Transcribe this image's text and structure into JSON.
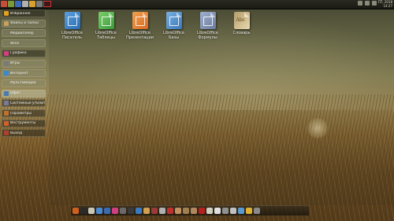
{
  "topbar": {
    "clock_line1": "ПТ, 2018",
    "clock_line2": "14:27",
    "icon_colors": [
      "#c84c3a",
      "#7a9a3a",
      "#3a6ab8",
      "#b0b0b0",
      "#d9a030",
      "#7a7a7a"
    ]
  },
  "menu": {
    "items": [
      {
        "label": "Избранное",
        "icon": "star-icon",
        "color": "#e0a020",
        "style": "dark"
      },
      {
        "label": "Файлы и папки",
        "icon": "folder-icon",
        "color": "#c8a060",
        "style": "normal"
      },
      {
        "label": "Медиаплеер",
        "icon": "",
        "color": "",
        "style": "normal"
      },
      {
        "label": "Wine",
        "icon": "",
        "color": "",
        "style": "normal"
      },
      {
        "label": "Графика",
        "icon": "graphics-icon",
        "color": "#d04080",
        "style": "dark"
      },
      {
        "label": "Игры",
        "icon": "game-icon",
        "color": "#7a7a7a",
        "style": "normal"
      },
      {
        "label": "Интернет",
        "icon": "globe-icon",
        "color": "#3a8ad0",
        "style": "normal"
      },
      {
        "label": "Мультимедиа",
        "icon": "",
        "color": "",
        "style": "normal"
      },
      {
        "label": "Офис",
        "icon": "office-icon",
        "color": "#4a7ab0",
        "style": "hi"
      },
      {
        "label": "Системные утилиты",
        "icon": "system-icon",
        "color": "#7a7a9a",
        "style": "dark"
      },
      {
        "label": "Параметры",
        "icon": "settings-icon",
        "color": "#c07030",
        "style": "dark"
      },
      {
        "label": "Инструменты",
        "icon": "tools-icon",
        "color": "#d06030",
        "style": "dark"
      },
      {
        "label": "Выход",
        "icon": "exit-icon",
        "color": "#b04030",
        "style": "dark"
      }
    ]
  },
  "apps": [
    {
      "line1": "LibreOffice",
      "line2": "Писатель",
      "color": "#2a6db0",
      "color2": "#5aa0e0",
      "icon": "writer-icon"
    },
    {
      "line1": "LibreOffice",
      "line2": "Таблицы",
      "color": "#3a9a3a",
      "color2": "#7ad06a",
      "icon": "calc-icon"
    },
    {
      "line1": "LibreOffice",
      "line2": "Презентации",
      "color": "#d86a20",
      "color2": "#f0a050",
      "icon": "impress-icon"
    },
    {
      "line1": "LibreOffice",
      "line2": "Базы",
      "color": "#3a78b8",
      "color2": "#7ab0e0",
      "icon": "base-icon"
    },
    {
      "line1": "LibreOffice",
      "line2": "Формулы",
      "color": "#6a7a9a",
      "color2": "#a0b0d0",
      "icon": "math-icon"
    },
    {
      "line1": "Abc",
      "line2": "Словарь",
      "color": "#e8d9b0",
      "color2": "#b59c6a",
      "icon": "dictionary-icon"
    }
  ],
  "dock": {
    "icons": [
      {
        "name": "dock-star-icon",
        "color": "#d06020"
      },
      {
        "name": "dock-clock-icon",
        "color": "#2a2a2a"
      },
      {
        "name": "dock-calculator-icon",
        "color": "#c8c8b8"
      },
      {
        "name": "dock-window-icon",
        "color": "#4a8ad0"
      },
      {
        "name": "dock-files-icon",
        "color": "#3a6ab0"
      },
      {
        "name": "dock-palette-icon",
        "color": "#d04080"
      },
      {
        "name": "dock-gear-icon",
        "color": "#6a6a6a"
      },
      {
        "name": "dock-terminal-icon",
        "color": "#3a3a3a"
      },
      {
        "name": "dock-monitor-icon",
        "color": "#3a7ac0"
      },
      {
        "name": "dock-folder-icon",
        "color": "#d0a050"
      },
      {
        "name": "dock-app-icon",
        "color": "#9a3a3a"
      },
      {
        "name": "dock-settings-icon",
        "color": "#b0b0b0"
      },
      {
        "name": "dock-record-icon",
        "color": "#c03030"
      },
      {
        "name": "dock-box-icon",
        "color": "#c09060"
      },
      {
        "name": "dock-box2-icon",
        "color": "#a08050"
      },
      {
        "name": "dock-box3-icon",
        "color": "#b08860"
      },
      {
        "name": "dock-red-icon",
        "color": "#b82020"
      },
      {
        "name": "dock-disc-icon",
        "color": "#d0d0c0"
      },
      {
        "name": "dock-power-icon",
        "color": "#e0e0e0"
      },
      {
        "name": "dock-screen-icon",
        "color": "#909090"
      },
      {
        "name": "dock-mail-icon",
        "color": "#c0c0c0"
      },
      {
        "name": "dock-network-icon",
        "color": "#5a9ad0"
      },
      {
        "name": "dock-weather-icon",
        "color": "#e0b030"
      },
      {
        "name": "dock-trash-icon",
        "color": "#8a8a8a"
      }
    ]
  }
}
